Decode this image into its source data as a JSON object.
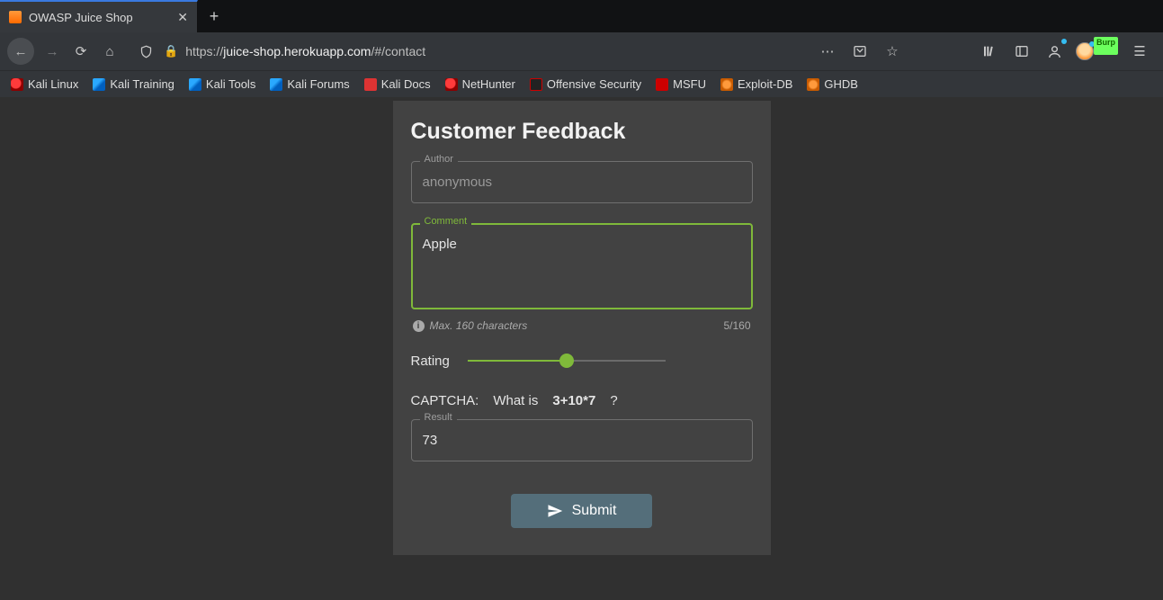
{
  "browser": {
    "tab_title": "OWASP Juice Shop",
    "url_prefix": "https://",
    "url_host": "juice-shop.herokuapp.com",
    "url_path": "/#/contact",
    "burp_label": "Burp"
  },
  "bookmarks": [
    {
      "label": "Kali Linux"
    },
    {
      "label": "Kali Training"
    },
    {
      "label": "Kali Tools"
    },
    {
      "label": "Kali Forums"
    },
    {
      "label": "Kali Docs"
    },
    {
      "label": "NetHunter"
    },
    {
      "label": "Offensive Security"
    },
    {
      "label": "MSFU"
    },
    {
      "label": "Exploit-DB"
    },
    {
      "label": "GHDB"
    }
  ],
  "form": {
    "title": "Customer Feedback",
    "author_label": "Author",
    "author_value": "anonymous",
    "comment_label": "Comment",
    "comment_value": "Apple",
    "comment_hint": "Max. 160 characters",
    "comment_counter": "5/160",
    "rating_label": "Rating",
    "rating_percent": 50,
    "captcha_label": "CAPTCHA:",
    "captcha_prompt": "What is",
    "captcha_expr": "3+10*7",
    "captcha_q": "?",
    "result_label": "Result",
    "result_value": "73",
    "submit_label": "Submit"
  }
}
